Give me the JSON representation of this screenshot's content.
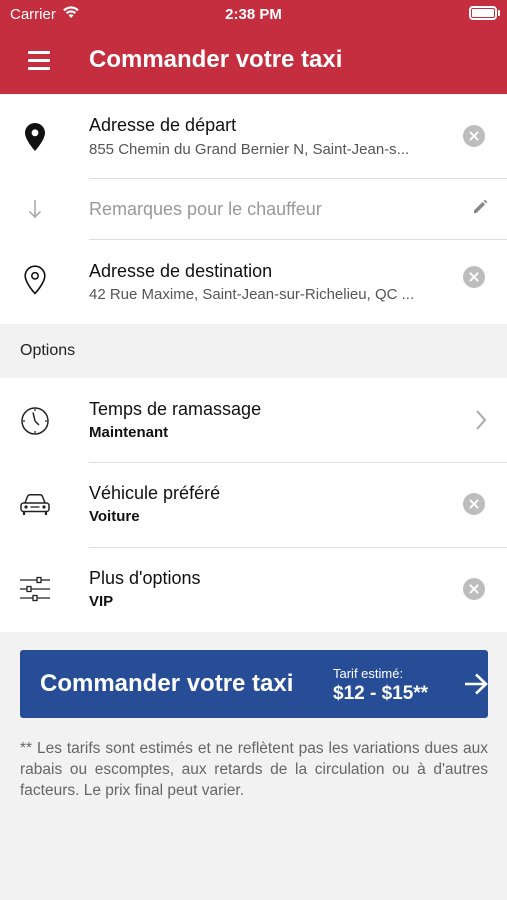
{
  "status_bar": {
    "carrier": "Carrier",
    "time": "2:38 PM"
  },
  "header": {
    "title": "Commander votre taxi"
  },
  "departure": {
    "label": "Adresse de départ",
    "address": "855 Chemin du Grand Bernier N, Saint-Jean-s..."
  },
  "remarks": {
    "placeholder": "Remarques pour le chauffeur"
  },
  "destination": {
    "label": "Adresse de destination",
    "address": "42 Rue Maxime, Saint-Jean-sur-Richelieu, QC ..."
  },
  "options_header": "Options",
  "options": [
    {
      "label": "Temps de ramassage",
      "value": "Maintenant"
    },
    {
      "label": "Véhicule préféré",
      "value": "Voiture"
    },
    {
      "label": "Plus d'options",
      "value": "VIP"
    }
  ],
  "order_button": {
    "label": "Commander votre taxi",
    "estimate_label": "Tarif estimé:",
    "price": "$12 - $15**"
  },
  "disclaimer": "** Les tarifs sont estimés et ne reflètent pas les variations dues aux rabais ou escomptes, aux retards de la circulation ou à d'autres facteurs. Le prix final peut varier.",
  "colors": {
    "brand": "#c42e3f",
    "button": "#274d97"
  }
}
